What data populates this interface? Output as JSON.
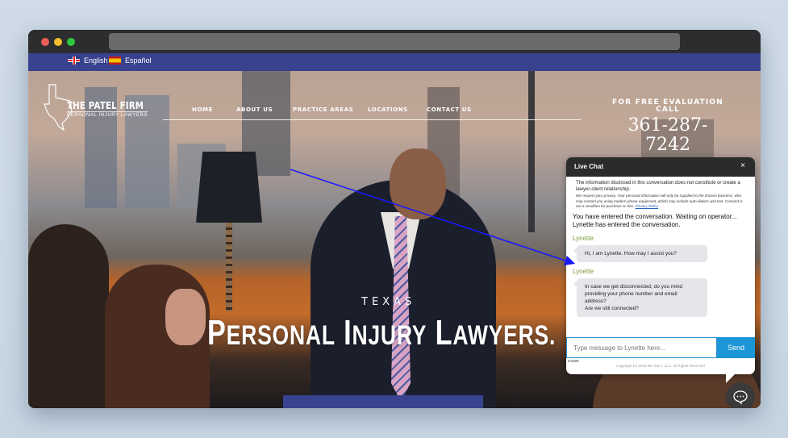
{
  "browser": {
    "url": ""
  },
  "language_bar": {
    "items": [
      {
        "label": "English",
        "flag": "uk-flag-icon"
      },
      {
        "label": "Español",
        "flag": "spain-flag-icon"
      }
    ]
  },
  "header": {
    "logo_name": "THE PATEL FIRM",
    "logo_tagline": "PERSONAL INJURY LAWYERS",
    "nav": [
      "HOME",
      "ABOUT US",
      "PRACTICE AREAS",
      "LOCATIONS",
      "CONTACT US"
    ],
    "cta_label_line1": "FOR FREE EVALUATION",
    "cta_label_line2": "CALL",
    "cta_phone_line1": "361-287-",
    "cta_phone_line2": "7242"
  },
  "hero": {
    "subtitle": "TEXAS",
    "title_words": [
      {
        "initial": "P",
        "rest": "ERSONAL"
      },
      {
        "initial": "I",
        "rest": "NJURY"
      },
      {
        "initial": "L",
        "rest": "AWYERS."
      }
    ]
  },
  "chat": {
    "title": "Live Chat",
    "close": "×",
    "disclaimer": "The information disclosed in this conversation does not constitute or create a lawyer-client relationship.",
    "privacy_text": "We respect your privacy. Your personal information will only be supplied to the chosen business, who may contact you using modern phone equipment, which may include auto-dialers and text. Consent is not a condition for purchase or hire.",
    "privacy_link": "Privacy Policy",
    "system_line1": "You have entered the conversation. Waiting on operator...",
    "system_line2": "Lynette has entered the conversation.",
    "messages": [
      {
        "sender": "Lynette",
        "text": "Hi, I am Lynette. How may I assist you?"
      },
      {
        "sender": "Lynette",
        "lines": [
          "In case we get disconnected, do you mind providing your phone number and email address?",
          "Are we still connected?"
        ]
      }
    ],
    "input_placeholder": "Type message to Lynette here...",
    "send_label": "Send",
    "char_counter": "0/1500",
    "copyright": "Copyright (c) 2023 MH Sub I, LLC. All Rights Reserved"
  },
  "annotation": {
    "color": "#1a1aff"
  },
  "colors": {
    "brand_blue": "#38428e",
    "send_blue": "#1b96d6",
    "sender_green": "#7c9a3a"
  }
}
